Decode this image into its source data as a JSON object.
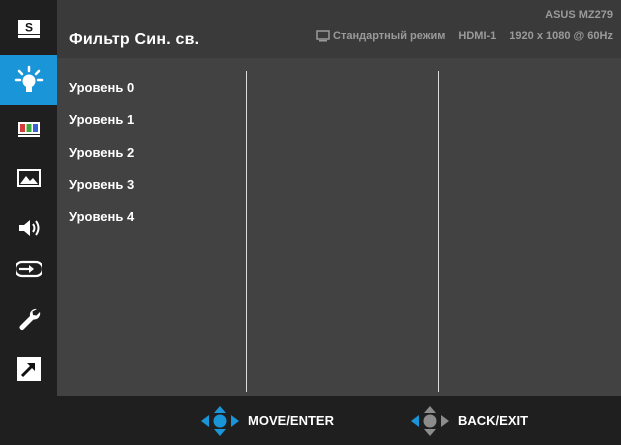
{
  "header": {
    "title": "Фильтр Син. св.",
    "model": "ASUS MZ279",
    "mode": "Стандартный режим",
    "input": "HDMI-1",
    "resolution": "1920 x 1080 @ 60Hz"
  },
  "sidebar": {
    "items": [
      {
        "icon": "splendid-s-icon"
      },
      {
        "icon": "blue-light-filter-icon",
        "active": true
      },
      {
        "icon": "color-bars-icon"
      },
      {
        "icon": "image-icon"
      },
      {
        "icon": "sound-icon"
      },
      {
        "icon": "input-select-icon"
      },
      {
        "icon": "wrench-icon"
      },
      {
        "icon": "shortcut-arrow-icon"
      }
    ]
  },
  "options": [
    "Уровень 0",
    "Уровень 1",
    "Уровень 2",
    "Уровень 3",
    "Уровень 4"
  ],
  "footer": {
    "move_label": "MOVE/ENTER",
    "back_label": "BACK/EXIT"
  },
  "colors": {
    "accent": "#1a96d8",
    "panel": "#424242",
    "bar": "#1f1f1f"
  }
}
